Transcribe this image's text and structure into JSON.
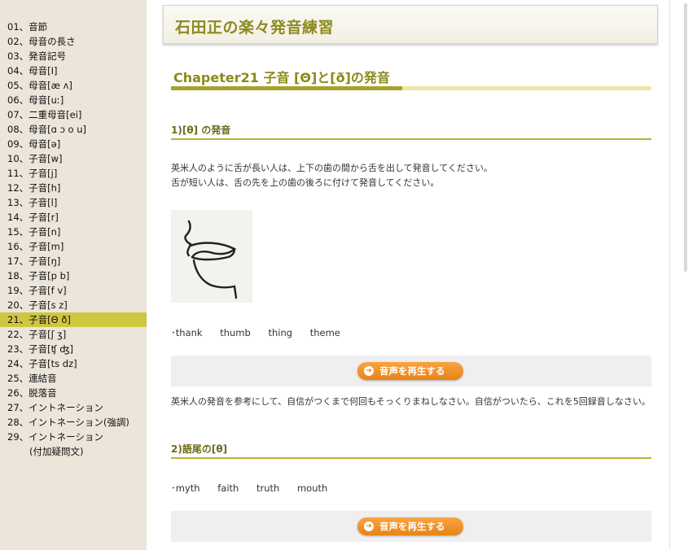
{
  "sidebar": {
    "items": [
      {
        "label": "01、音節"
      },
      {
        "label": "02、母音の長さ"
      },
      {
        "label": "03、発音記号"
      },
      {
        "label": "04、母音[I]"
      },
      {
        "label": "05、母音[æ ʌ]"
      },
      {
        "label": "06、母音[uː]"
      },
      {
        "label": "07、二重母音[ei]"
      },
      {
        "label": "08、母音[ɑ ɔ o u]"
      },
      {
        "label": "09、母音[ə]"
      },
      {
        "label": "10、子音[w]"
      },
      {
        "label": "11、子音[j]"
      },
      {
        "label": "12、子音[h]"
      },
      {
        "label": "13、子音[l]"
      },
      {
        "label": "14、子音[r]"
      },
      {
        "label": "15、子音[n]"
      },
      {
        "label": "16、子音[m]"
      },
      {
        "label": "17、子音[ŋ]"
      },
      {
        "label": "18、子音[p b]"
      },
      {
        "label": "19、子音[f v]"
      },
      {
        "label": "20、子音[s z]"
      },
      {
        "label": "21、子音[Θ ð]",
        "active": true
      },
      {
        "label": "22、子音[ʃ ʒ]"
      },
      {
        "label": "23、子音[ʧ ʤ]"
      },
      {
        "label": "24、子音[ts dz]"
      },
      {
        "label": "25、連結音"
      },
      {
        "label": "26、脱落音"
      },
      {
        "label": "27、イントネーション"
      },
      {
        "label": "28、イントネーション(強調)"
      },
      {
        "label": "29、イントネーション"
      },
      {
        "label": "(付加疑問文)"
      }
    ]
  },
  "header": {
    "site_title": "石田正の楽々発音練習"
  },
  "chapter": {
    "title": "Chapeter21  子音 [Θ]と[ð]の発音"
  },
  "section1": {
    "title": "1)[θ] の発音",
    "text_line1": "英米人のように舌が長い人は、上下の歯の間から舌を出して発音してください。",
    "text_line2": "舌が短い人は、舌の先を上の歯の後ろに付けて発音してください。",
    "words": [
      "･thank",
      "thumb",
      "thing",
      "theme"
    ],
    "play_label": "音声を再生する",
    "instruction": "英米人の発音を参考にして、自信がつくまで何回もそっくりまねしなさい。自信がついたら、これを5回録音しなさい。"
  },
  "section2": {
    "title": "2)語尾の[θ]",
    "words": [
      "･myth",
      "faith",
      "truth",
      "mouth"
    ],
    "play_label": "音声を再生する"
  },
  "colors": {
    "accent": "#8e8a1e",
    "active_item": "#cfc740",
    "play_button": "#e98316"
  }
}
